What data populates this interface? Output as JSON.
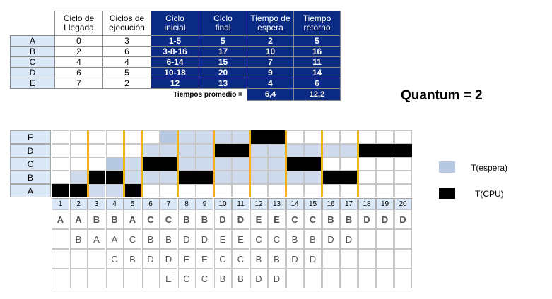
{
  "table": {
    "headers": [
      "Ciclo de\nLlegada",
      "Ciclos de\nejecución",
      "Ciclo\ninicial",
      "Ciclo\nfinal",
      "Tiempo de\nespera",
      "Tiempo\nretorno"
    ],
    "rows": [
      {
        "name": "A",
        "llegada": "0",
        "ejecucion": "3",
        "inicial": "1-5",
        "final": "5",
        "espera": "2",
        "retorno": "5"
      },
      {
        "name": "B",
        "llegada": "2",
        "ejecucion": "6",
        "inicial": "3-8-16",
        "final": "17",
        "espera": "10",
        "retorno": "16"
      },
      {
        "name": "C",
        "llegada": "4",
        "ejecucion": "4",
        "inicial": "6-14",
        "final": "15",
        "espera": "7",
        "retorno": "11"
      },
      {
        "name": "D",
        "llegada": "6",
        "ejecucion": "5",
        "inicial": "10-18",
        "final": "20",
        "espera": "9",
        "retorno": "14"
      },
      {
        "name": "E",
        "llegada": "7",
        "ejecucion": "2",
        "inicial": "12",
        "final": "13",
        "espera": "4",
        "retorno": "6"
      }
    ],
    "avg_label": "Tiempos promedio =",
    "avg_espera": "6,4",
    "avg_retorno": "12,2"
  },
  "quantum_label": "Quantum = 2",
  "gantt": {
    "rows": [
      "E",
      "D",
      "C",
      "B",
      "A"
    ],
    "cycles": [
      "1",
      "2",
      "3",
      "4",
      "5",
      "6",
      "7",
      "8",
      "9",
      "10",
      "11",
      "12",
      "13",
      "14",
      "15",
      "16",
      "17",
      "18",
      "19",
      "20"
    ],
    "cpu": {
      "A": [
        1,
        2,
        5
      ],
      "B": [
        3,
        4,
        8,
        9,
        16,
        17
      ],
      "C": [
        6,
        7,
        14,
        15
      ],
      "D": [
        10,
        11,
        18,
        19,
        20
      ],
      "E": [
        12,
        13
      ]
    },
    "wait": {
      "A": [
        3,
        4
      ],
      "B": [
        2,
        5,
        6,
        7,
        10,
        11,
        12,
        13,
        14,
        15
      ],
      "C": [
        4,
        5,
        8,
        9,
        10,
        11,
        12,
        13
      ],
      "D": [
        6,
        7,
        8,
        9,
        12,
        13,
        14,
        15,
        16,
        17
      ],
      "E": [
        7,
        8,
        9,
        10,
        11
      ]
    },
    "highlight_wait": {
      "C": [
        4
      ],
      "E": [
        7
      ]
    },
    "quantum_boundaries": [
      2,
      4,
      5,
      7,
      9,
      11,
      13,
      15,
      17
    ]
  },
  "legend": {
    "wait_label": "T(espera)",
    "cpu_label": "T(CPU)",
    "wait_color": "#b7c9e2",
    "cpu_color": "#000000"
  },
  "queue": {
    "rows": [
      [
        "A",
        "A",
        "B",
        "B",
        "A",
        "C",
        "C",
        "B",
        "B",
        "D",
        "D",
        "E",
        "E",
        "C",
        "C",
        "B",
        "B",
        "D",
        "D",
        "D"
      ],
      [
        "",
        "B",
        "A",
        "A",
        "C",
        "B",
        "B",
        "D",
        "D",
        "E",
        "E",
        "C",
        "C",
        "B",
        "B",
        "D",
        "D",
        "",
        "",
        ""
      ],
      [
        "",
        "",
        "",
        "C",
        "B",
        "D",
        "D",
        "E",
        "E",
        "C",
        "C",
        "B",
        "B",
        "D",
        "D",
        "",
        "",
        "",
        "",
        ""
      ],
      [
        "",
        "",
        "",
        "",
        "",
        "",
        "E",
        "C",
        "C",
        "B",
        "B",
        "D",
        "D",
        "",
        "",
        "",
        "",
        "",
        "",
        ""
      ]
    ]
  }
}
